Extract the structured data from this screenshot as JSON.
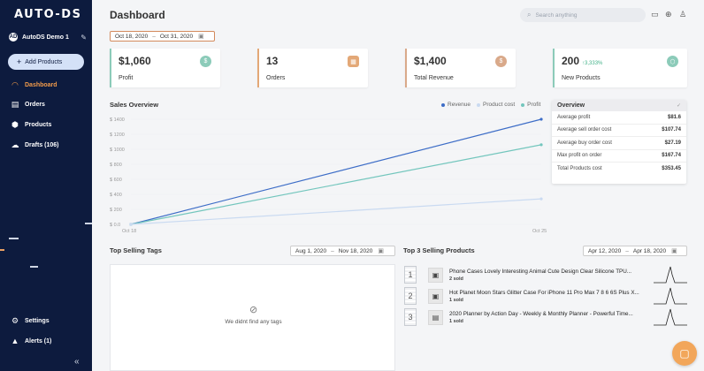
{
  "sidebar": {
    "logo": "AUTO-DS",
    "store_initials": "AD",
    "store_name": "AutoDS Demo 1",
    "add_products": "Add Products",
    "items": [
      {
        "label": "Dashboard",
        "icon": "gauge-icon",
        "glyph": "◠"
      },
      {
        "label": "Orders",
        "icon": "orders-icon",
        "glyph": "▤"
      },
      {
        "label": "Products",
        "icon": "box-icon",
        "glyph": "⬢"
      },
      {
        "label": "Drafts (106)",
        "icon": "cloud-upload-icon",
        "glyph": "☁"
      },
      {
        "label": "Settings",
        "icon": "gear-icon",
        "glyph": "⚙"
      },
      {
        "label": "Alerts (1)",
        "icon": "bell-icon",
        "glyph": "♠"
      }
    ]
  },
  "header": {
    "title": "Dashboard",
    "search_placeholder": "Search anything"
  },
  "date_ranges": {
    "main": {
      "from": "Oct 18, 2020",
      "to": "Oct 31, 2020"
    },
    "tags": {
      "from": "Aug 1, 2020",
      "to": "Nov 18, 2020"
    },
    "products": {
      "from": "Apr 12, 2020",
      "to": "Apr 18, 2020"
    }
  },
  "stats": [
    {
      "value": "$1,060",
      "sub": "",
      "label": "Profit",
      "color": "#8ccbb9",
      "icon": "dollar-badge-icon",
      "glyph": "$"
    },
    {
      "value": "13",
      "sub": "",
      "label": "Orders",
      "color": "#e3a877",
      "icon": "clipboard-icon",
      "glyph": "▦"
    },
    {
      "value": "$1,400",
      "sub": "",
      "label": "Total Revenue",
      "color": "#d9a98a",
      "icon": "dollar-icon",
      "glyph": "$"
    },
    {
      "value": "200",
      "sub": "↑3,333%",
      "label": "New Products",
      "color": "#8ccbb9",
      "icon": "box-plus-icon",
      "glyph": "⬡"
    }
  ],
  "sales": {
    "title": "Sales Overview",
    "legend": [
      {
        "name": "Revenue",
        "color": "#3d6dc7"
      },
      {
        "name": "Product cost",
        "color": "#c9daf1"
      },
      {
        "name": "Profit",
        "color": "#73c6bd"
      }
    ]
  },
  "chart_data": {
    "type": "line",
    "x": [
      "Oct 18",
      "Oct 25"
    ],
    "yticks": [
      "$ 0.0",
      "$ 200",
      "$ 400",
      "$ 600",
      "$ 800",
      "$ 1000",
      "$ 1200",
      "$ 1400"
    ],
    "ylim": [
      0,
      1400
    ],
    "series": [
      {
        "name": "Revenue",
        "values": [
          0,
          1400
        ],
        "color": "#3d6dc7"
      },
      {
        "name": "Profit",
        "values": [
          0,
          1060
        ],
        "color": "#73c6bd"
      },
      {
        "name": "Product cost",
        "values": [
          0,
          340
        ],
        "color": "#c9daf1"
      }
    ],
    "grid": true,
    "legend_position": "top-right"
  },
  "overview": {
    "title": "Overview",
    "rows": [
      {
        "label": "Average profit",
        "value": "$81.6"
      },
      {
        "label": "Average sell order cost",
        "value": "$107.74"
      },
      {
        "label": "Average buy order cost",
        "value": "$27.19"
      },
      {
        "label": "Max profit on order",
        "value": "$167.74"
      },
      {
        "label": "Total Products cost",
        "value": "$353.45"
      }
    ]
  },
  "tags": {
    "title": "Top Selling Tags",
    "empty": "We didnt find any tags"
  },
  "products": {
    "title": "Top 3 Selling Products",
    "items": [
      {
        "rank": "1",
        "name": "Phone Cases Lovely Interesting Animal Cute Design Clear Silicone TPU...",
        "sold": "2 sold"
      },
      {
        "rank": "2",
        "name": "Hot Planet Moon Stars Glitter Case For iPhone 11 Pro Max 7 8 6 6S Plus X...",
        "sold": "1 sold"
      },
      {
        "rank": "3",
        "name": "2020 Planner by Action Day - Weekly & Monthly Planner - Powerful Time...",
        "sold": "1 sold"
      }
    ]
  }
}
